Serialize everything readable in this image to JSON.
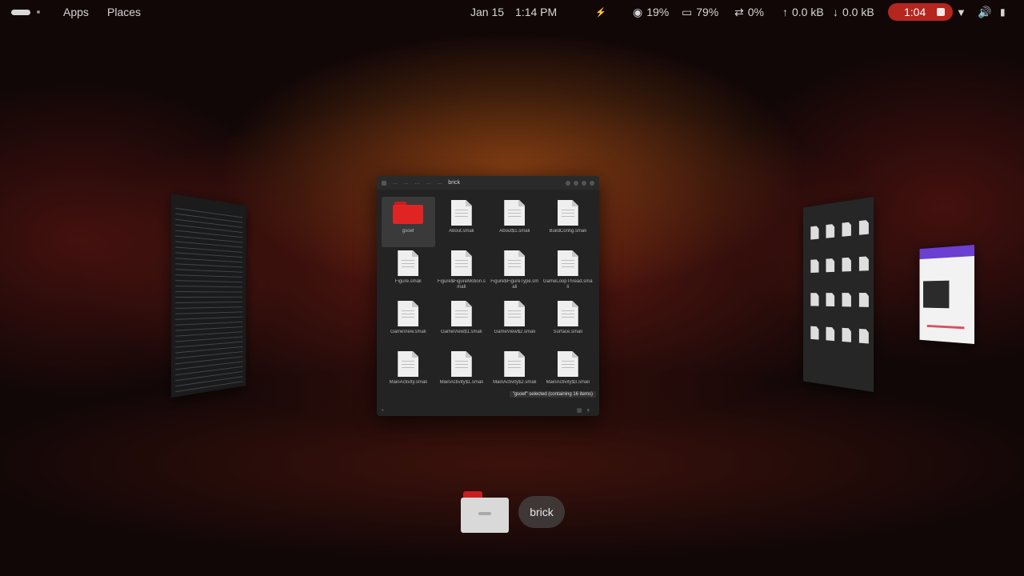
{
  "topbar": {
    "apps_label": "Apps",
    "places_label": "Places",
    "date": "Jan 15",
    "time": "1:14 PM",
    "cpu": "19%",
    "memory": "79%",
    "swap": "0%",
    "upload": "0.0 kB",
    "download": "0.0 kB",
    "recording_time": "1:04"
  },
  "file_manager": {
    "breadcrumbs": [
      "...",
      "...",
      "...",
      "...",
      "...",
      "brick"
    ],
    "items": [
      {
        "name": "gsoef",
        "type": "folder",
        "selected": true
      },
      {
        "name": "About.smali",
        "type": "file"
      },
      {
        "name": "About$1.smali",
        "type": "file"
      },
      {
        "name": "BuildConfig.smali",
        "type": "file"
      },
      {
        "name": "Figure.smali",
        "type": "file"
      },
      {
        "name": "Figure$FigureMotion.smali",
        "type": "file"
      },
      {
        "name": "Figure$FigureType.smali",
        "type": "file"
      },
      {
        "name": "GameLoopThread.smali",
        "type": "file"
      },
      {
        "name": "GameView.smali",
        "type": "file"
      },
      {
        "name": "GameView$1.smali",
        "type": "file"
      },
      {
        "name": "GameView$2.smali",
        "type": "file"
      },
      {
        "name": "Surface.smali",
        "type": "file"
      },
      {
        "name": "MainActivity.smali",
        "type": "file"
      },
      {
        "name": "MainActivity$1.smali",
        "type": "file"
      },
      {
        "name": "MainActivity$2.smali",
        "type": "file"
      },
      {
        "name": "MainActivity$3.smali",
        "type": "file"
      }
    ],
    "status_text": "\"gsoef\" selected (containing 16 items)"
  },
  "dock": {
    "app_label": "brick"
  },
  "colors": {
    "accent_red": "#e02424",
    "recording_red": "#b5261e"
  }
}
